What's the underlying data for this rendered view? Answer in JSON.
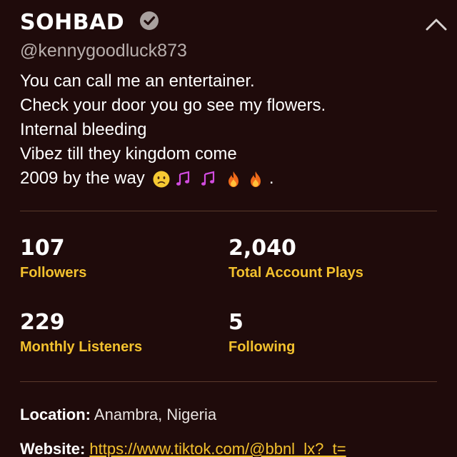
{
  "profile": {
    "name": "SOHBAD",
    "handle": "@kennygoodluck873",
    "verified_icon": "verified-check-icon",
    "collapse_icon": "chevron-up-icon"
  },
  "bio": {
    "lines": [
      "You can call me an entertainer.",
      "Check your door you go see my flowers.",
      "Internal bleeding",
      "Vibez till they kingdom come",
      "2009 by the way"
    ],
    "last_line_suffix": ".",
    "emojis": [
      "slightly-frowning-face",
      "musical-notes",
      "musical-notes",
      "fire",
      "fire"
    ]
  },
  "stats": {
    "followers": {
      "value": "107",
      "label": "Followers"
    },
    "total_plays": {
      "value": "2,040",
      "label": "Total Account Plays"
    },
    "monthly_listeners": {
      "value": "229",
      "label": "Monthly Listeners"
    },
    "following": {
      "value": "5",
      "label": "Following"
    }
  },
  "info": {
    "location_label": "Location:",
    "location_value": "Anambra, Nigeria",
    "website_label": "Website:",
    "website_value": "https://www.tiktok.com/@bbnl_lx?_t="
  },
  "colors": {
    "background": "#1f0b0b",
    "accent": "#f3c12e",
    "divider": "#5a3a2c",
    "muted_text": "#b9b0ae"
  }
}
